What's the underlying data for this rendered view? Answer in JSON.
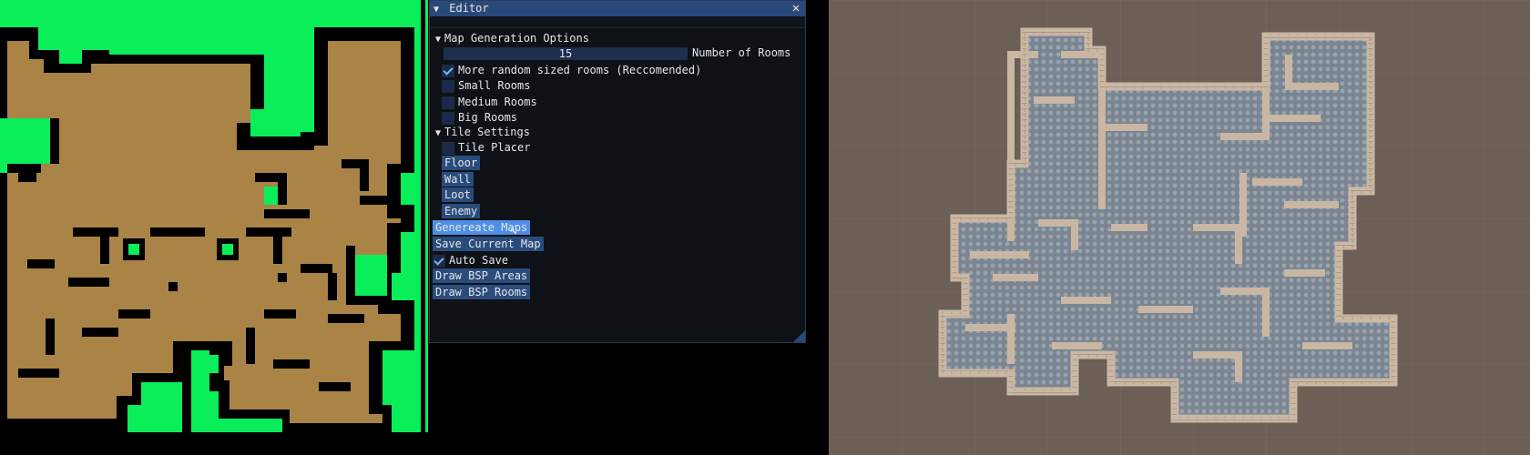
{
  "colors": {
    "map_bg": "#0aee5a",
    "map_wall": "#000000",
    "map_floor": "#a98446",
    "editor_bg": "#0e1116",
    "title_bg": "#29497a",
    "button_bg": "#2a4c7d",
    "button_hover": "#4d8fe6",
    "scene_bg": "#6b5f56",
    "scene_floor": "#808b97",
    "scene_wall": "#c9b7a3"
  },
  "editor": {
    "title": "Editor",
    "close_icon": "close-icon",
    "map_generation_header": "Map Generation Options",
    "num_rooms_value": "15",
    "num_rooms_label": "Number of Rooms",
    "checkboxes": {
      "random_sized": {
        "label": "More random sized rooms (Reccomended)",
        "checked": true
      },
      "small_rooms": {
        "label": "Small Rooms",
        "checked": false
      },
      "medium_rooms": {
        "label": "Medium Rooms",
        "checked": false
      },
      "big_rooms": {
        "label": "Big Rooms",
        "checked": false
      }
    },
    "tile_settings_header": "Tile Settings",
    "tile_placer_label": "Tile Placer",
    "tile_buttons": [
      "Floor",
      "Wall",
      "Loot",
      "Enemy"
    ],
    "generate_button": "Genereate Maps",
    "save_button": "Save Current Map",
    "auto_save_label": "Auto Save",
    "draw_bsp_areas": "Draw BSP Areas",
    "draw_bsp_rooms": "Draw BSP Rooms"
  }
}
